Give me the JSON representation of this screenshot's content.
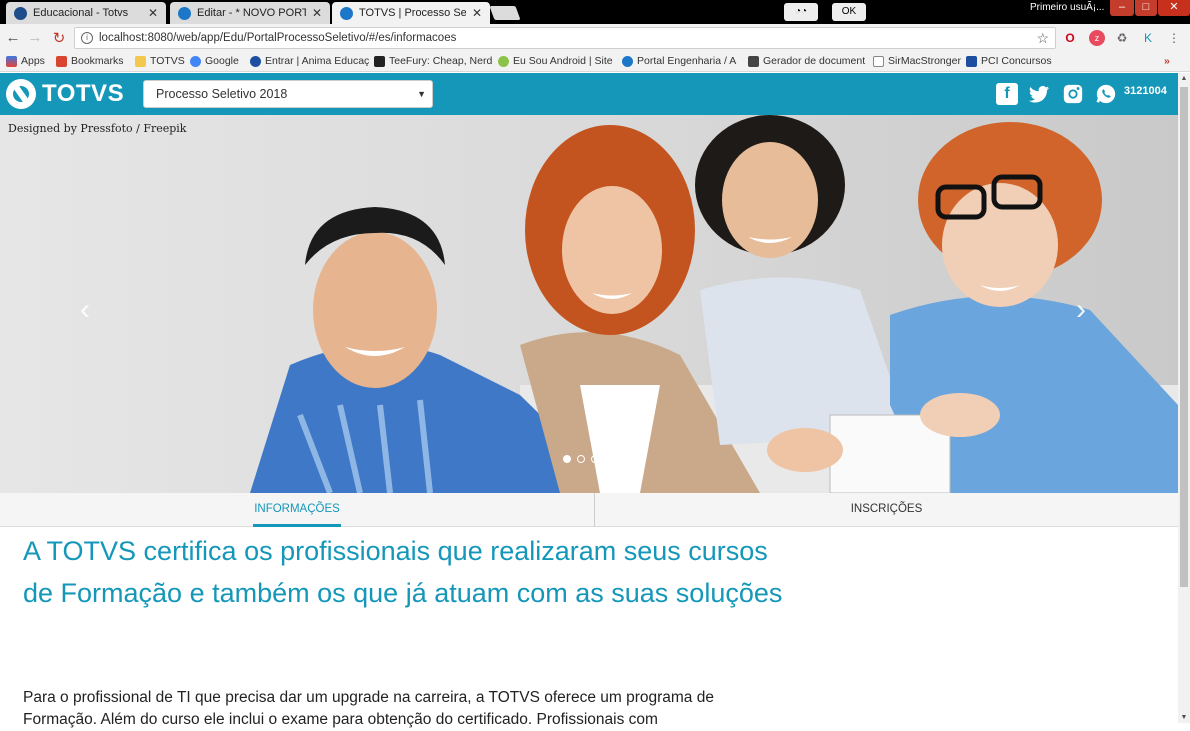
{
  "browser": {
    "tabs": [
      {
        "title": "Educacional - Totvs",
        "active": false
      },
      {
        "title": "Editar - * NOVO PORTAL",
        "active": false
      },
      {
        "title": "TOTVS | Processo Seletivo",
        "active": true
      }
    ],
    "profile_badge": "OK",
    "user_label": "Primeiro usuÃ¡...",
    "window_buttons": {
      "minimize": "–",
      "maximize": "□",
      "close": "✕"
    },
    "url": "localhost:8080/web/app/Edu/PortalProcessoSeletivo/#/es/informacoes",
    "bookmarks": [
      {
        "label": "Apps",
        "icon": "apps-grid-icon"
      },
      {
        "label": "Bookmarks",
        "icon": "star-icon"
      },
      {
        "label": "TOTVS",
        "icon": "folder-icon"
      },
      {
        "label": "Google",
        "icon": "google-icon"
      },
      {
        "label": "Entrar | Anima Educaç",
        "icon": "globe-icon"
      },
      {
        "label": "TeeFury: Cheap, Nerd",
        "icon": "teefury-icon"
      },
      {
        "label": "Eu Sou Android | Site",
        "icon": "android-icon"
      },
      {
        "label": "Portal Engenharia / A",
        "icon": "globe-icon"
      },
      {
        "label": "Gerador de document",
        "icon": "hash-icon"
      },
      {
        "label": "SirMacStronger",
        "icon": "page-icon"
      },
      {
        "label": "PCI Concursos",
        "icon": "pci-icon"
      }
    ],
    "bookmarks_overflow": "»"
  },
  "header": {
    "logo_text": "TOTVS",
    "select_value": "Processo Seletivo 2018",
    "phone": "3121004",
    "social": [
      "facebook-icon",
      "twitter-icon",
      "instagram-icon",
      "whatsapp-icon"
    ]
  },
  "hero": {
    "credit": "Designed by Pressfoto / Freepik",
    "slide_count": 4,
    "active_slide": 1
  },
  "tabs": [
    {
      "label": "INFORMAÇÕES",
      "active": true
    },
    {
      "label": "INSCRIÇÕES",
      "active": false
    }
  ],
  "content": {
    "headline": "A TOTVS certifica os profissionais que realizaram seus cursos de Formação e também os que já atuam com as suas soluções",
    "body": "Para o profissional de TI que precisa dar um upgrade na carreira, a TOTVS oferece um programa de Formação. Além do curso ele inclui o exame para obtenção do certificado. Profissionais com"
  },
  "colors": {
    "brand": "#1497b9",
    "text": "#222222"
  }
}
